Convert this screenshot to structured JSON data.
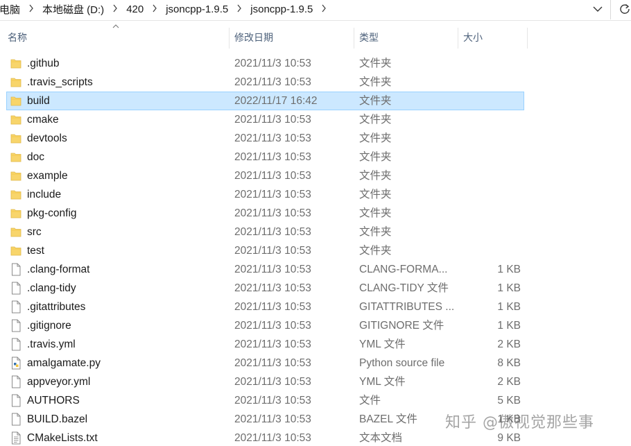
{
  "breadcrumb": {
    "items": [
      "电脑",
      "本地磁盘 (D:)",
      "420",
      "jsoncpp-1.9.5",
      "jsoncpp-1.9.5"
    ]
  },
  "icons": {
    "separator": "chevron-right-icon",
    "dropdown": "chevron-down-icon",
    "refresh": "refresh-icon",
    "folder": "folder-icon",
    "file": "file-icon",
    "sort": "sort-up-icon"
  },
  "columns": {
    "name": "名称",
    "modified": "修改日期",
    "type": "类型",
    "size": "大小"
  },
  "colors": {
    "selection_bg": "#cce8ff",
    "selection_border": "#99d1ff",
    "folder_yellow": "#f8d56b",
    "header_text": "#4c607a"
  },
  "files": [
    {
      "name": ".github",
      "date": "2021/11/3 10:53",
      "type": "文件夹",
      "size": "",
      "kind": "folder"
    },
    {
      "name": ".travis_scripts",
      "date": "2021/11/3 10:53",
      "type": "文件夹",
      "size": "",
      "kind": "folder"
    },
    {
      "name": "build",
      "date": "2022/11/17 16:42",
      "type": "文件夹",
      "size": "",
      "kind": "folder",
      "selected": true
    },
    {
      "name": "cmake",
      "date": "2021/11/3 10:53",
      "type": "文件夹",
      "size": "",
      "kind": "folder"
    },
    {
      "name": "devtools",
      "date": "2021/11/3 10:53",
      "type": "文件夹",
      "size": "",
      "kind": "folder"
    },
    {
      "name": "doc",
      "date": "2021/11/3 10:53",
      "type": "文件夹",
      "size": "",
      "kind": "folder"
    },
    {
      "name": "example",
      "date": "2021/11/3 10:53",
      "type": "文件夹",
      "size": "",
      "kind": "folder"
    },
    {
      "name": "include",
      "date": "2021/11/3 10:53",
      "type": "文件夹",
      "size": "",
      "kind": "folder"
    },
    {
      "name": "pkg-config",
      "date": "2021/11/3 10:53",
      "type": "文件夹",
      "size": "",
      "kind": "folder"
    },
    {
      "name": "src",
      "date": "2021/11/3 10:53",
      "type": "文件夹",
      "size": "",
      "kind": "folder"
    },
    {
      "name": "test",
      "date": "2021/11/3 10:53",
      "type": "文件夹",
      "size": "",
      "kind": "folder"
    },
    {
      "name": ".clang-format",
      "date": "2021/11/3 10:53",
      "type": "CLANG-FORMA...",
      "size": "1 KB",
      "kind": "file"
    },
    {
      "name": ".clang-tidy",
      "date": "2021/11/3 10:53",
      "type": "CLANG-TIDY 文件",
      "size": "1 KB",
      "kind": "file"
    },
    {
      "name": ".gitattributes",
      "date": "2021/11/3 10:53",
      "type": "GITATTRIBUTES ...",
      "size": "1 KB",
      "kind": "file"
    },
    {
      "name": ".gitignore",
      "date": "2021/11/3 10:53",
      "type": "GITIGNORE 文件",
      "size": "1 KB",
      "kind": "file"
    },
    {
      "name": ".travis.yml",
      "date": "2021/11/3 10:53",
      "type": "YML 文件",
      "size": "2 KB",
      "kind": "file"
    },
    {
      "name": "amalgamate.py",
      "date": "2021/11/3 10:53",
      "type": "Python source file",
      "size": "8 KB",
      "kind": "python"
    },
    {
      "name": "appveyor.yml",
      "date": "2021/11/3 10:53",
      "type": "YML 文件",
      "size": "2 KB",
      "kind": "file"
    },
    {
      "name": "AUTHORS",
      "date": "2021/11/3 10:53",
      "type": "文件",
      "size": "5 KB",
      "kind": "file"
    },
    {
      "name": "BUILD.bazel",
      "date": "2021/11/3 10:53",
      "type": "BAZEL 文件",
      "size": "1 KB",
      "kind": "file"
    },
    {
      "name": "CMakeLists.txt",
      "date": "2021/11/3 10:53",
      "type": "文本文档",
      "size": "9 KB",
      "kind": "text"
    }
  ],
  "watermark": "知乎 @傲视觉那些事"
}
